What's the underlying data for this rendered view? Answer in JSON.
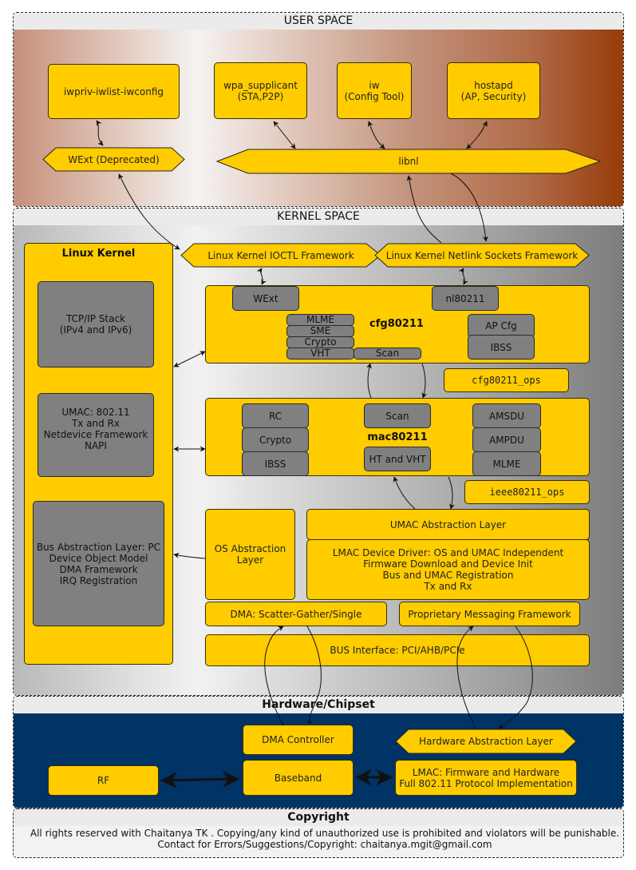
{
  "user_space": {
    "title": "USER SPACE",
    "iwpriv": "iwpriv-iwlist-iwconfig",
    "wpa_supplicant": "wpa_supplicant\n(STA,P2P)",
    "iw": "iw\n(Config Tool)",
    "hostapd": "hostapd\n(AP, Security)",
    "wext": "WExt (Deprecated)",
    "libnl": "libnl"
  },
  "kernel_space": {
    "title": "KERNEL SPACE",
    "linux_kernel": {
      "title": "Linux Kernel",
      "tcpip": "TCP/IP Stack\n(IPv4 and IPv6)",
      "umac": "UMAC: 802.11\nTx and Rx\nNetdevice Framework\nNAPI",
      "bus": "Bus Abstraction Layer: PC\nDevice Object Model\nDMA Framework\nIRQ Registration"
    },
    "ioctl_framework": "Linux Kernel IOCTL Framework",
    "netlink_framework": "Linux Kernel Netlink Sockets Framework",
    "cfg80211": {
      "title": "cfg80211",
      "wext": "WExt",
      "nl80211": "nl80211",
      "stack": [
        "MLME",
        "SME",
        "Crypto",
        "VHT"
      ],
      "scan": "Scan",
      "ap_cfg": "AP Cfg",
      "ibss": "IBSS"
    },
    "cfg80211_ops": "cfg80211_ops",
    "mac80211": {
      "title": "mac80211",
      "left": [
        "RC",
        "Crypto",
        "IBSS"
      ],
      "scan": "Scan",
      "ht_vht": "HT and VHT",
      "right": [
        "AMSDU",
        "AMPDU",
        "MLME"
      ]
    },
    "ieee80211_ops": "ieee80211_ops",
    "os_abstraction": "OS Abstraction\nLayer",
    "umac_abstraction": "UMAC Abstraction Layer",
    "lmac_driver": "LMAC Device Driver: OS and UMAC Independent\nFirmware Download and Device Init\nBus and UMAC Registration\nTx and Rx",
    "dma": "DMA: Scatter-Gather/Single",
    "proprietary": "Proprietary Messaging Framework",
    "bus_interface": "BUS Interface: PCI/AHB/PCIe"
  },
  "hardware": {
    "title": "Hardware/Chipset",
    "dma_controller": "DMA Controller",
    "hal": "Hardware Abstraction Layer",
    "rf": "RF",
    "baseband": "Baseband",
    "lmac": "LMAC: Firmware and Hardware\nFull 802.11 Protocol Implementation"
  },
  "copyright": {
    "title": "Copyright",
    "text": "All rights reserved with Chaitanya TK . Copying/any kind of unauthorized use is prohibited and violators will be punishable.\nContact for Errors/Suggestions/Copyright: chaitanya.mgit@gmail.com"
  },
  "colors": {
    "component": "#ffcc00",
    "subcomponent": "#808080",
    "hardware_bg": "#003366",
    "user_space_dark": "#973b0a"
  }
}
